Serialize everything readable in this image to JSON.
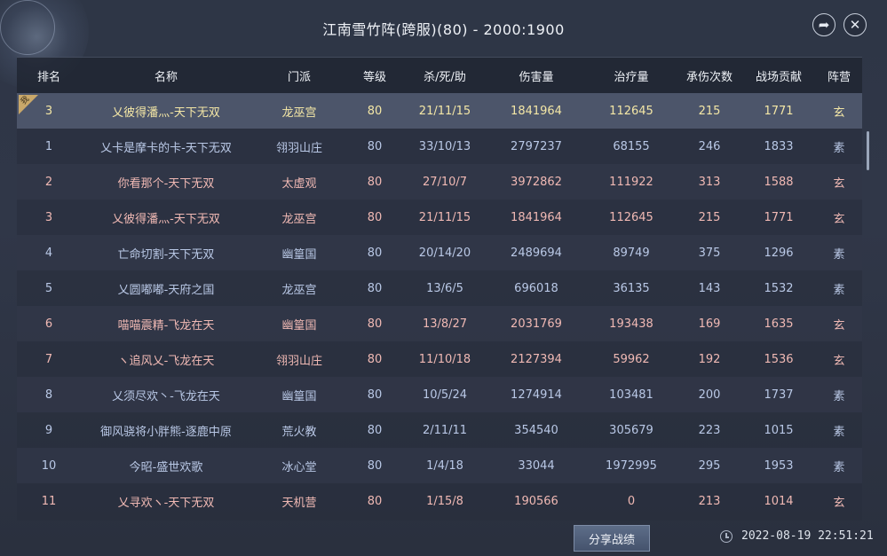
{
  "title": "江南雪竹阵(跨服)(80) - 2000:1900",
  "header_icons": {
    "share": "share-arrow-icon",
    "close": "close-icon"
  },
  "columns": [
    "排名",
    "名称",
    "门派",
    "等级",
    "杀/死/助",
    "伤害量",
    "治疗量",
    "承伤次数",
    "战场贡献",
    "阵营"
  ],
  "me_badge": "我",
  "rows": [
    {
      "rank": "3",
      "name": "乂彼得潘灬-天下无双",
      "sect": "龙巫宫",
      "level": "80",
      "kda": "21/11/15",
      "damage": "1841964",
      "heal": "112645",
      "hits": "215",
      "contrib": "1771",
      "camp": "玄",
      "tone": "gold",
      "mine": true
    },
    {
      "rank": "1",
      "name": "乂卡是摩卡的卡-天下无双",
      "sect": "翎羽山庄",
      "level": "80",
      "kda": "33/10/13",
      "damage": "2797237",
      "heal": "68155",
      "hits": "246",
      "contrib": "1833",
      "camp": "素",
      "tone": "blue"
    },
    {
      "rank": "2",
      "name": "你看那个-天下无双",
      "sect": "太虚观",
      "level": "80",
      "kda": "27/10/7",
      "damage": "3972862",
      "heal": "111922",
      "hits": "313",
      "contrib": "1588",
      "camp": "玄",
      "tone": "pink"
    },
    {
      "rank": "3",
      "name": "乂彼得潘灬-天下无双",
      "sect": "龙巫宫",
      "level": "80",
      "kda": "21/11/15",
      "damage": "1841964",
      "heal": "112645",
      "hits": "215",
      "contrib": "1771",
      "camp": "玄",
      "tone": "pink"
    },
    {
      "rank": "4",
      "name": "亡命切割-天下无双",
      "sect": "幽篁国",
      "level": "80",
      "kda": "20/14/20",
      "damage": "2489694",
      "heal": "89749",
      "hits": "375",
      "contrib": "1296",
      "camp": "素",
      "tone": "blue"
    },
    {
      "rank": "5",
      "name": "乂圆嘟嘟-天府之国",
      "sect": "龙巫宫",
      "level": "80",
      "kda": "13/6/5",
      "damage": "696018",
      "heal": "36135",
      "hits": "143",
      "contrib": "1532",
      "camp": "素",
      "tone": "blue"
    },
    {
      "rank": "6",
      "name": "喵喵震精-飞龙在天",
      "sect": "幽篁国",
      "level": "80",
      "kda": "13/8/27",
      "damage": "2031769",
      "heal": "193438",
      "hits": "169",
      "contrib": "1635",
      "camp": "玄",
      "tone": "pink"
    },
    {
      "rank": "7",
      "name": "ヽ追风乂-飞龙在天",
      "sect": "翎羽山庄",
      "level": "80",
      "kda": "11/10/18",
      "damage": "2127394",
      "heal": "59962",
      "hits": "192",
      "contrib": "1536",
      "camp": "玄",
      "tone": "pink"
    },
    {
      "rank": "8",
      "name": "乂须尽欢丶-飞龙在天",
      "sect": "幽篁国",
      "level": "80",
      "kda": "10/5/24",
      "damage": "1274914",
      "heal": "103481",
      "hits": "200",
      "contrib": "1737",
      "camp": "素",
      "tone": "blue"
    },
    {
      "rank": "9",
      "name": "御风骁将小胖熊-逐鹿中原",
      "sect": "荒火教",
      "level": "80",
      "kda": "2/11/11",
      "damage": "354540",
      "heal": "305679",
      "hits": "223",
      "contrib": "1015",
      "camp": "素",
      "tone": "blue"
    },
    {
      "rank": "10",
      "name": "今昭-盛世欢歌",
      "sect": "冰心堂",
      "level": "80",
      "kda": "1/4/18",
      "damage": "33044",
      "heal": "1972995",
      "hits": "295",
      "contrib": "1953",
      "camp": "素",
      "tone": "blue"
    },
    {
      "rank": "11",
      "name": "乂寻欢ヽ-天下无双",
      "sect": "天机营",
      "level": "80",
      "kda": "1/15/8",
      "damage": "190566",
      "heal": "0",
      "hits": "213",
      "contrib": "1014",
      "camp": "玄",
      "tone": "pink"
    }
  ],
  "footer": {
    "share_button": "分享战绩",
    "timestamp": "2022-08-19 22:51:21"
  },
  "colors": {
    "blue_team": "#b9c8e6",
    "pink_team": "#f0b9b4",
    "highlight": "#f4e7a6"
  }
}
